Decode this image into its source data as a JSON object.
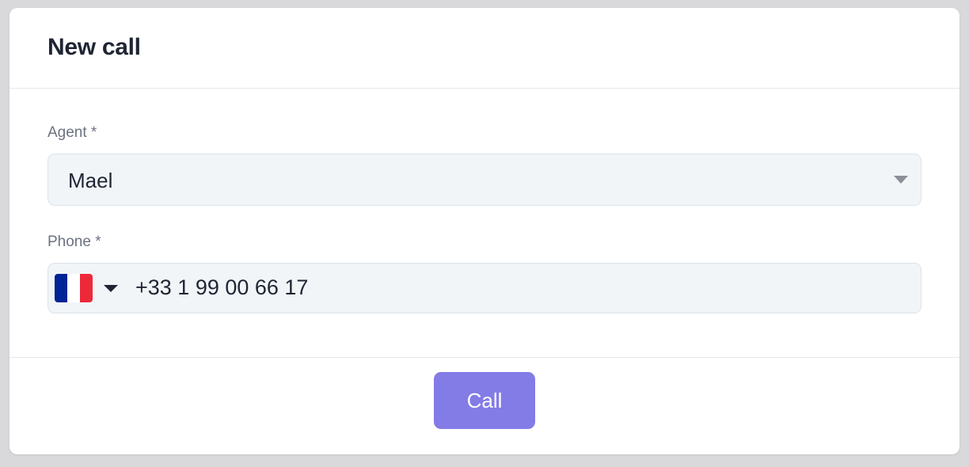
{
  "modal": {
    "title": "New call"
  },
  "form": {
    "agent": {
      "label": "Agent *",
      "value": "Mael"
    },
    "phone": {
      "label": "Phone *",
      "country_icon": "france-flag-icon",
      "flag_colors": [
        "#002395",
        "#ffffff",
        "#ed2939"
      ],
      "value": "+33 1 99 00 66 17"
    }
  },
  "actions": {
    "call_label": "Call"
  },
  "colors": {
    "accent": "#837ce6",
    "field_background": "#f1f5f8",
    "title_text": "#1f2533",
    "label_text": "#6b7280"
  }
}
